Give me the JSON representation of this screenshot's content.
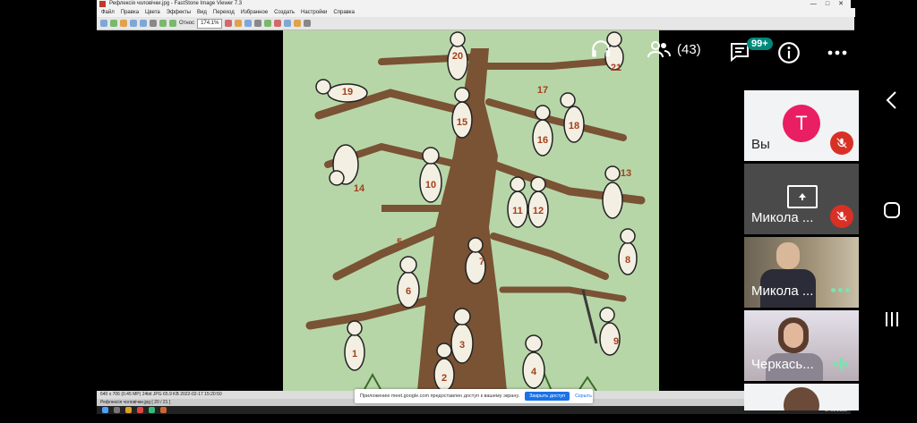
{
  "window": {
    "title": "Рефлексія чоловічки.jpg - FastStone Image Viewer 7.3",
    "controls": [
      "—",
      "□",
      "✕"
    ]
  },
  "menu": [
    "Файл",
    "Правка",
    "Цвета",
    "Эффекты",
    "Вид",
    "Переход",
    "Избранное",
    "Создать",
    "Настройки",
    "Справка"
  ],
  "toolbar": {
    "zoom_label": "Относ",
    "zoom_value": "174.1%"
  },
  "picture": {
    "figure_numbers": [
      "1",
      "2",
      "3",
      "4",
      "5",
      "6",
      "7",
      "8",
      "9",
      "10",
      "11",
      "12",
      "13",
      "14",
      "15",
      "16",
      "17",
      "18",
      "19",
      "20",
      "21"
    ]
  },
  "status": {
    "info": "640 x 706 (0.45 MP)   24bit   JPG   65.9 KB   2022-02-17 15:20:50",
    "file": "Рефлексія чоловічки.jpg [ 20 / 21 ]"
  },
  "share_notice": {
    "text": "Приложению meet.google.com предоставлен доступ к вашему экрану.",
    "stop_label": "Закрыть доступ",
    "hide_label": "Скрыть"
  },
  "taskbar": {
    "clock": "17.02.2022"
  },
  "meet": {
    "participants_count": "(43)",
    "chat_badge": "99+",
    "tiles": [
      {
        "initial": "Т",
        "name": "Вы",
        "avatar_color": "#e91e63",
        "status": "muted"
      },
      {
        "name": "Микола ...",
        "status": "muted",
        "presenting": true
      },
      {
        "name": "Микола ...",
        "status": "speaking-dots"
      },
      {
        "name": "Черкась...",
        "status": "speaking-bars"
      }
    ]
  },
  "colors": {
    "accent": "#00897b",
    "mute": "#d93025",
    "picture_bg": "#b7d6a8",
    "tree": "#7a5234"
  }
}
